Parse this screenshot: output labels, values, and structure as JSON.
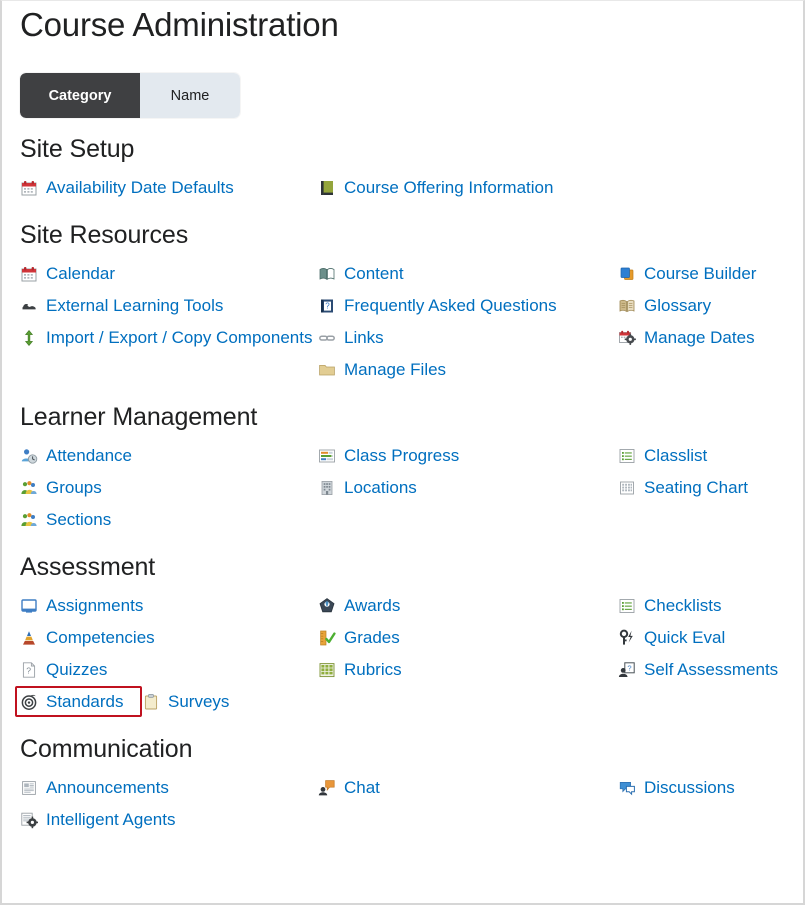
{
  "page": {
    "title": "Course Administration"
  },
  "toggle": {
    "category_label": "Category",
    "name_label": "Name",
    "active": "Category",
    "active_bg": "#3f4042",
    "inactive_bg": "#e3e9ef"
  },
  "theme": {
    "link_color": "#006fbf",
    "heading_color": "#202122",
    "highlight_color": "#c0111f",
    "background": "#ffffff"
  },
  "highlight": {
    "target": "Standards"
  },
  "sections": [
    {
      "heading": "Site Setup",
      "rows": [
        [
          {
            "label": "Availability Date Defaults",
            "icon": "calendar-icon"
          },
          {
            "label": "Course Offering Information",
            "icon": "green-book-icon"
          },
          {
            "label": "",
            "icon": ""
          }
        ]
      ]
    },
    {
      "heading": "Site Resources",
      "rows": [
        [
          {
            "label": "Calendar",
            "icon": "calendar-icon"
          },
          {
            "label": "Content",
            "icon": "open-book-icon"
          },
          {
            "label": "Course Builder",
            "icon": "stacked-pages-icon"
          }
        ],
        [
          {
            "label": "External Learning Tools",
            "icon": "puzzle-icon"
          },
          {
            "label": "Frequently Asked Questions",
            "icon": "question-book-icon"
          },
          {
            "label": "Glossary",
            "icon": "glossary-book-icon"
          }
        ],
        [
          {
            "label": "Import / Export / Copy Components",
            "icon": "up-down-arrow-icon"
          },
          {
            "label": "Links",
            "icon": "chain-link-icon"
          },
          {
            "label": "Manage Dates",
            "icon": "calendar-gear-icon"
          }
        ],
        [
          {
            "label": "",
            "icon": ""
          },
          {
            "label": "Manage Files",
            "icon": "folder-icon"
          },
          {
            "label": "",
            "icon": ""
          }
        ]
      ]
    },
    {
      "heading": "Learner Management",
      "rows": [
        [
          {
            "label": "Attendance",
            "icon": "person-clock-icon"
          },
          {
            "label": "Class Progress",
            "icon": "progress-bars-icon"
          },
          {
            "label": "Classlist",
            "icon": "list-icon"
          }
        ],
        [
          {
            "label": "Groups",
            "icon": "people-group-icon"
          },
          {
            "label": "Locations",
            "icon": "building-icon"
          },
          {
            "label": "Seating Chart",
            "icon": "grid-icon"
          }
        ],
        [
          {
            "label": "Sections",
            "icon": "people-group-icon"
          },
          {
            "label": "",
            "icon": ""
          },
          {
            "label": "",
            "icon": ""
          }
        ]
      ]
    },
    {
      "heading": "Assessment",
      "rows": [
        [
          {
            "label": "Assignments",
            "icon": "monitor-icon"
          },
          {
            "label": "Awards",
            "icon": "award-badge-icon"
          },
          {
            "label": "Checklists",
            "icon": "list-icon"
          }
        ],
        [
          {
            "label": "Competencies",
            "icon": "pyramid-icon"
          },
          {
            "label": "Grades",
            "icon": "ruler-check-icon"
          },
          {
            "label": "Quick Eval",
            "icon": "key-lightning-icon"
          }
        ],
        [
          {
            "label": "Quizzes",
            "icon": "question-page-icon"
          },
          {
            "label": "Rubrics",
            "icon": "rubric-grid-icon"
          },
          {
            "label": "Self Assessments",
            "icon": "person-question-icon"
          }
        ],
        [
          {
            "label": "Standards",
            "icon": "target-swirl-icon"
          },
          {
            "label": "Surveys",
            "icon": "clipboard-icon"
          },
          {
            "label": "",
            "icon": ""
          }
        ]
      ]
    },
    {
      "heading": "Communication",
      "rows": [
        [
          {
            "label": "Announcements",
            "icon": "news-page-icon"
          },
          {
            "label": "Chat",
            "icon": "chat-person-icon"
          },
          {
            "label": "Discussions",
            "icon": "discussion-bubbles-icon"
          }
        ],
        [
          {
            "label": "Intelligent Agents",
            "icon": "agent-gear-icon"
          },
          {
            "label": "",
            "icon": ""
          },
          {
            "label": "",
            "icon": ""
          }
        ]
      ]
    }
  ]
}
